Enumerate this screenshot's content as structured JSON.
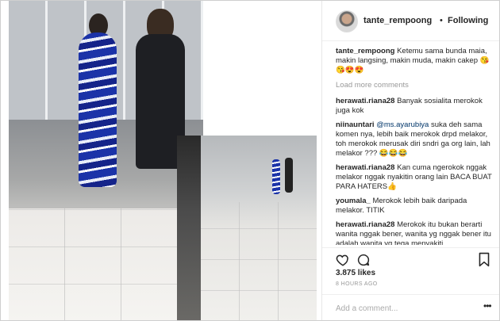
{
  "post": {
    "username": "tante_rempoong",
    "separator": "•",
    "follow_status": "Following",
    "caption": {
      "user": "tante_rempoong",
      "text": "Ketemu sama bunda maia, makin langsing, makin muda, makin cakep 😘😘😍😍"
    },
    "load_more": "Load more comments",
    "comments": [
      {
        "user": "herawati.riana28",
        "mention": "",
        "text": "Banyak sosialita merokok juga kok"
      },
      {
        "user": "niinauntari",
        "mention": "@ms.ayarubiya",
        "text": "suka deh sama komen nya, lebih baik merokok drpd melakor, toh merokok merusak diri sndri ga org lain, lah melakor ??? 😂😂😂"
      },
      {
        "user": "herawati.riana28",
        "mention": "",
        "text": "Kan cuma ngerokok nggak melakor nggak nyakitin orang lain BACA BUAT PARA HATERS👍"
      },
      {
        "user": "youmala_",
        "mention": "",
        "text": "Merokok lebih baik daripada melakor. TITIK"
      },
      {
        "user": "herawati.riana28",
        "mention": "",
        "text": "Merokok itu bukan berarti wanita nggak bener, wanita yg nggak bener itu adalah wanita yg tega menyakiti"
      }
    ],
    "likes": "3.875 likes",
    "time": "8 HOURS AGO",
    "add_comment_placeholder": "Add a comment...",
    "more_label": "•••"
  },
  "icons": {
    "like": "heart-icon",
    "comment": "comment-icon",
    "save": "bookmark-icon",
    "options": "more-icon"
  },
  "colors": {
    "text": "#262626",
    "muted": "#999999",
    "mention": "#003569",
    "border": "#efefef"
  }
}
